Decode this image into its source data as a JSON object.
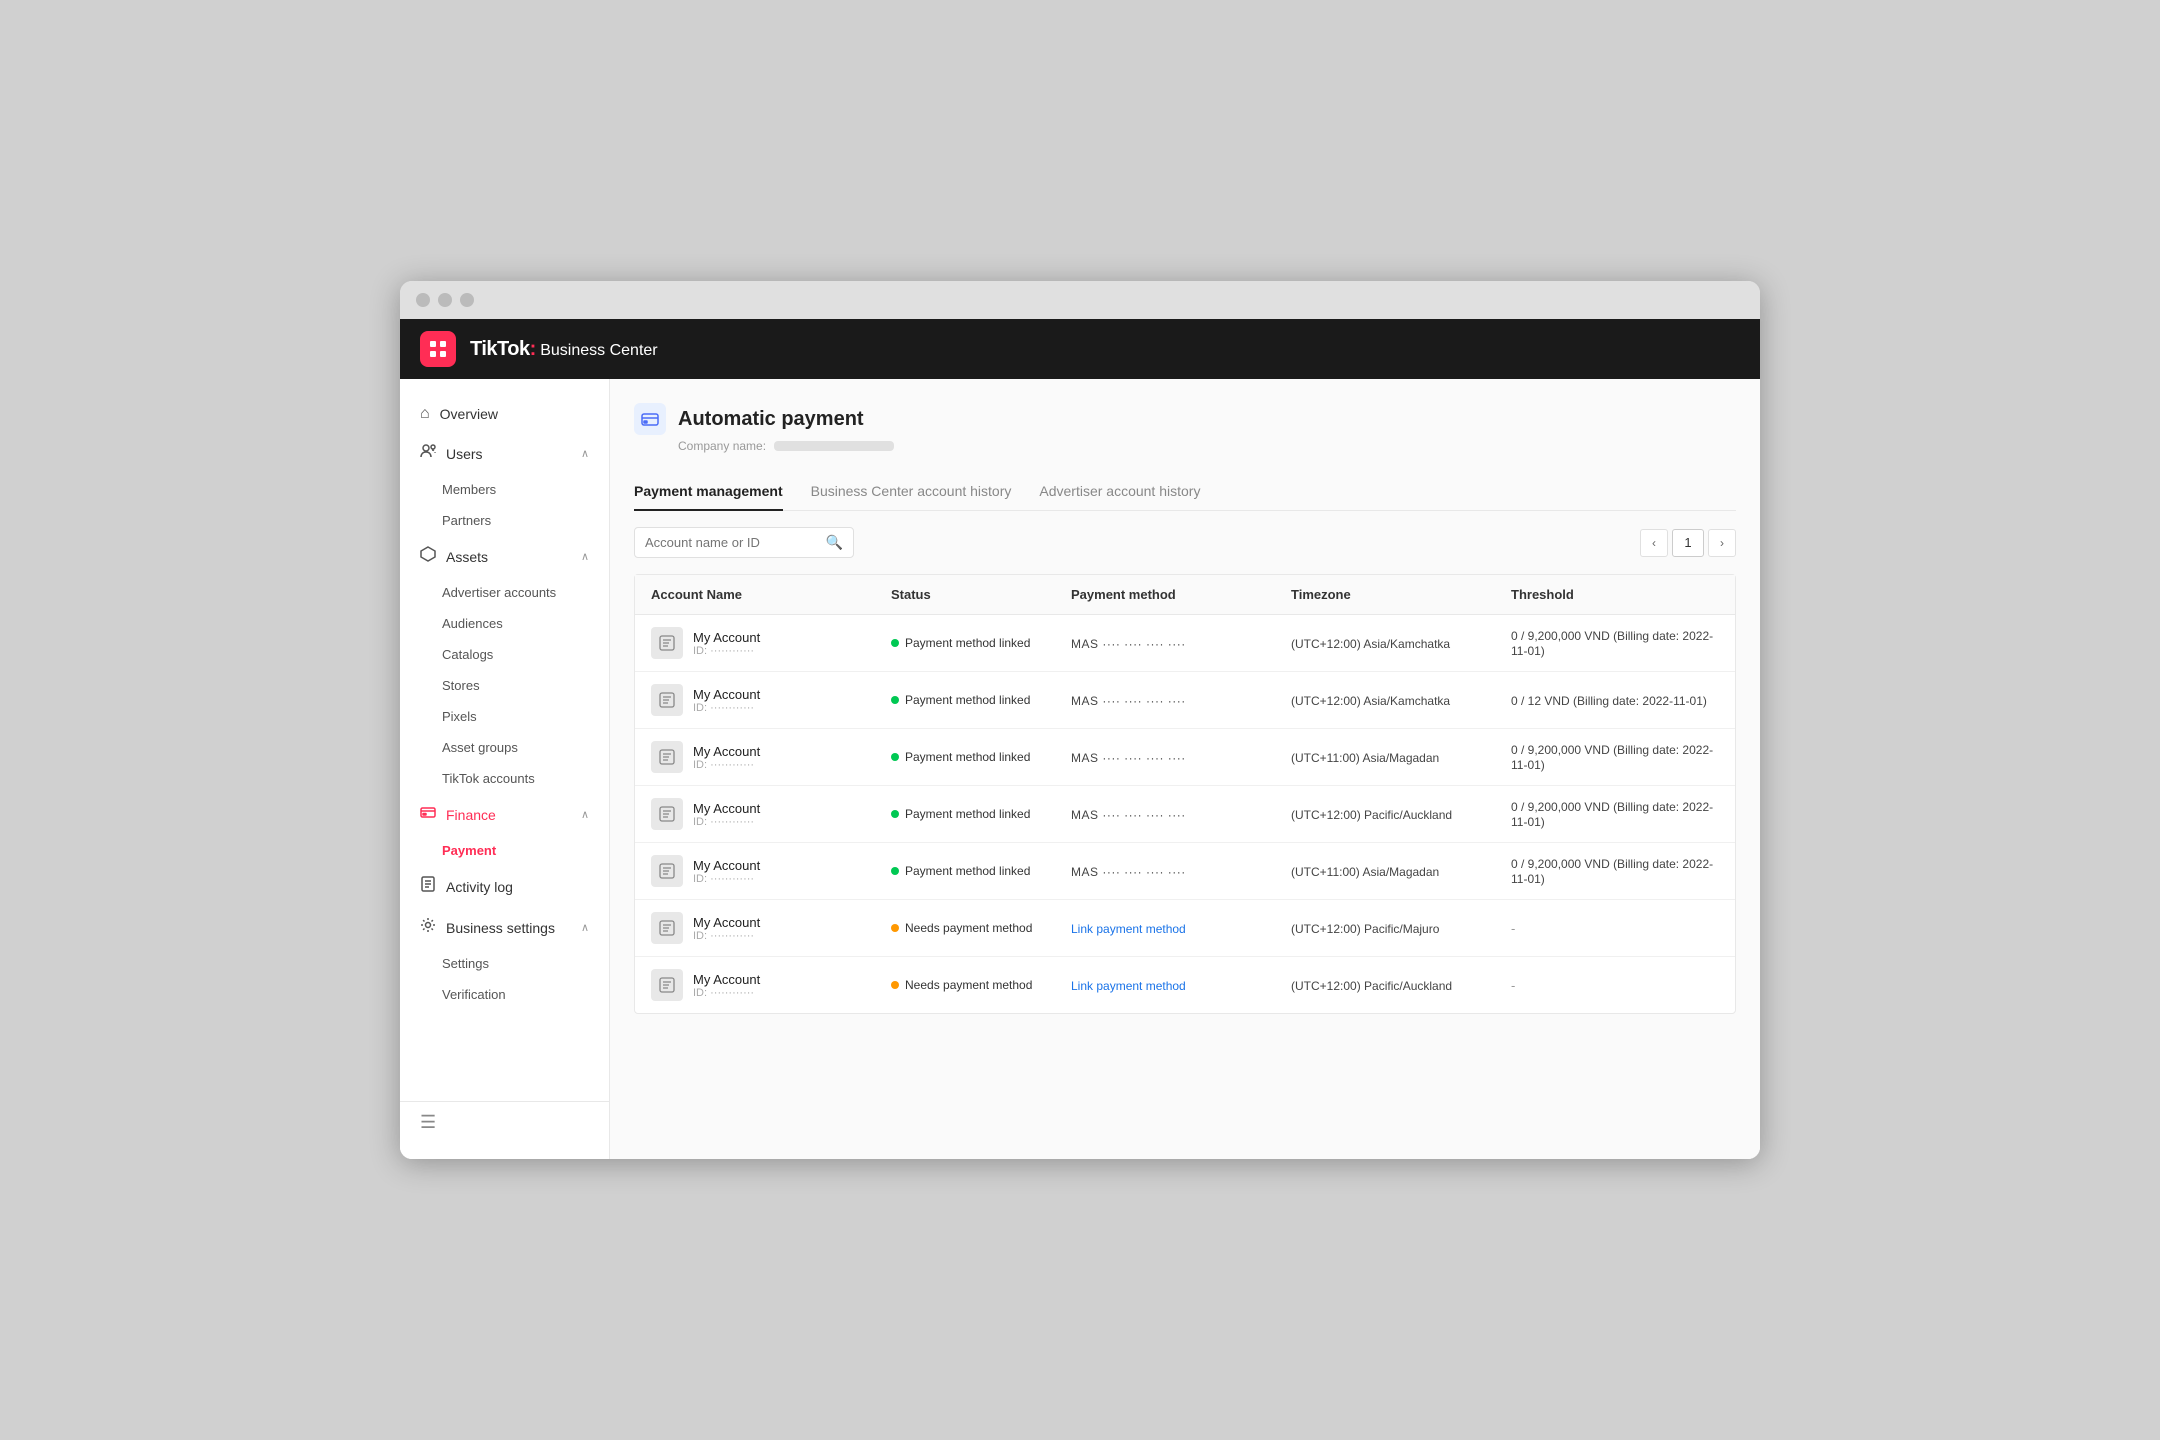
{
  "browser": {
    "dots": [
      "",
      "",
      ""
    ]
  },
  "topnav": {
    "brand": "TikTok",
    "colon": ":",
    "subtitle": " Business Center"
  },
  "sidebar": {
    "items": [
      {
        "id": "overview",
        "label": "Overview",
        "icon": "⌂",
        "hasChevron": false
      },
      {
        "id": "users",
        "label": "Users",
        "icon": "👤",
        "hasChevron": true
      },
      {
        "id": "members",
        "label": "Members",
        "sub": true
      },
      {
        "id": "partners",
        "label": "Partners",
        "sub": true
      },
      {
        "id": "assets",
        "label": "Assets",
        "icon": "⬡",
        "hasChevron": true
      },
      {
        "id": "advertiser-accounts",
        "label": "Advertiser accounts",
        "sub": true
      },
      {
        "id": "audiences",
        "label": "Audiences",
        "sub": true
      },
      {
        "id": "catalogs",
        "label": "Catalogs",
        "sub": true
      },
      {
        "id": "stores",
        "label": "Stores",
        "sub": true
      },
      {
        "id": "pixels",
        "label": "Pixels",
        "sub": true
      },
      {
        "id": "asset-groups",
        "label": "Asset groups",
        "sub": true
      },
      {
        "id": "tiktok-accounts",
        "label": "TikTok accounts",
        "sub": true
      },
      {
        "id": "finance",
        "label": "Finance",
        "icon": "💳",
        "hasChevron": true,
        "active": true
      },
      {
        "id": "payment",
        "label": "Payment",
        "sub": true,
        "active": true
      },
      {
        "id": "activity-log",
        "label": "Activity log",
        "icon": "📄",
        "hasChevron": false
      },
      {
        "id": "business-settings",
        "label": "Business settings",
        "icon": "⚙",
        "hasChevron": true
      },
      {
        "id": "settings",
        "label": "Settings",
        "sub": true
      },
      {
        "id": "verification",
        "label": "Verification",
        "sub": true
      }
    ],
    "collapse_icon": "☰"
  },
  "page": {
    "title": "Automatic payment",
    "icon": "💳",
    "company_label": "Company name:",
    "tabs": [
      {
        "id": "payment-management",
        "label": "Payment management",
        "active": true
      },
      {
        "id": "bc-account-history",
        "label": "Business Center account history",
        "active": false
      },
      {
        "id": "advertiser-account-history",
        "label": "Advertiser account history",
        "active": false
      }
    ],
    "search_placeholder": "Account name or ID",
    "pagination": {
      "prev_icon": "‹",
      "next_icon": "›",
      "current_page": "1"
    },
    "table": {
      "headers": [
        "Account Name",
        "Status",
        "Payment method",
        "Timezone",
        "Threshold"
      ],
      "rows": [
        {
          "account_name": "My Account",
          "account_id": "ID: ············",
          "status": "Payment method linked",
          "status_type": "green",
          "payment_method": "MAS ···· ···· ···· ····",
          "timezone": "(UTC+12:00) Asia/Kamchatka",
          "threshold": "0 / 9,200,000 VND (Billing date: 2022-11-01)"
        },
        {
          "account_name": "My Account",
          "account_id": "ID: ············",
          "status": "Payment method linked",
          "status_type": "green",
          "payment_method": "MAS ···· ···· ···· ····",
          "timezone": "(UTC+12:00) Asia/Kamchatka",
          "threshold": "0 / 12 VND (Billing date: 2022-11-01)"
        },
        {
          "account_name": "My Account",
          "account_id": "ID: ············",
          "status": "Payment method linked",
          "status_type": "green",
          "payment_method": "MAS ···· ···· ···· ····",
          "timezone": "(UTC+11:00) Asia/Magadan",
          "threshold": "0 / 9,200,000 VND (Billing date: 2022-11-01)"
        },
        {
          "account_name": "My Account",
          "account_id": "ID: ············",
          "status": "Payment method linked",
          "status_type": "green",
          "payment_method": "MAS ···· ···· ···· ····",
          "timezone": "(UTC+12:00) Pacific/Auckland",
          "threshold": "0 / 9,200,000 VND (Billing date: 2022-11-01)"
        },
        {
          "account_name": "My Account",
          "account_id": "ID: ············",
          "status": "Payment method linked",
          "status_type": "green",
          "payment_method": "MAS ···· ···· ···· ····",
          "timezone": "(UTC+11:00) Asia/Magadan",
          "threshold": "0 / 9,200,000 VND (Billing date: 2022-11-01)"
        },
        {
          "account_name": "My Account",
          "account_id": "ID: ············",
          "status": "Needs payment method",
          "status_type": "orange",
          "payment_method": "link",
          "payment_method_link_label": "Link payment method",
          "timezone": "(UTC+12:00) Pacific/Majuro",
          "threshold": "-"
        },
        {
          "account_name": "My Account",
          "account_id": "ID: ············",
          "status": "Needs payment method",
          "status_type": "orange",
          "payment_method": "link",
          "payment_method_link_label": "Link payment method",
          "timezone": "(UTC+12:00) Pacific/Auckland",
          "threshold": "-"
        }
      ]
    }
  }
}
